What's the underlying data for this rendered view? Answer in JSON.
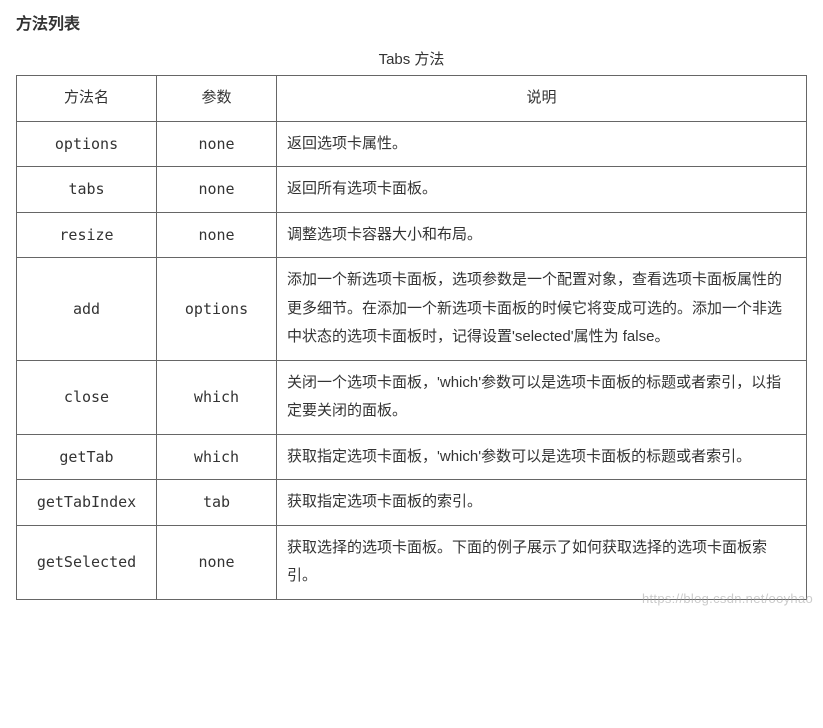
{
  "section_title": "方法列表",
  "table_caption": "Tabs 方法",
  "headers": {
    "method": "方法名",
    "param": "参数",
    "desc": "说明"
  },
  "rows": [
    {
      "method": "options",
      "param": "none",
      "desc": "返回选项卡属性。"
    },
    {
      "method": "tabs",
      "param": "none",
      "desc": "返回所有选项卡面板。"
    },
    {
      "method": "resize",
      "param": "none",
      "desc": "调整选项卡容器大小和布局。"
    },
    {
      "method": "add",
      "param": "options",
      "desc": "添加一个新选项卡面板，选项参数是一个配置对象，查看选项卡面板属性的更多细节。在添加一个新选项卡面板的时候它将变成可选的。添加一个非选中状态的选项卡面板时，记得设置'selected'属性为 false。"
    },
    {
      "method": "close",
      "param": "which",
      "desc": "关闭一个选项卡面板，'which'参数可以是选项卡面板的标题或者索引，以指定要关闭的面板。"
    },
    {
      "method": "getTab",
      "param": "which",
      "desc": "获取指定选项卡面板，'which'参数可以是选项卡面板的标题或者索引。"
    },
    {
      "method": "getTabIndex",
      "param": "tab",
      "desc": "获取指定选项卡面板的索引。"
    },
    {
      "method": "getSelected",
      "param": "none",
      "desc": "获取选择的选项卡面板。下面的例子展示了如何获取选择的选项卡面板索引。"
    }
  ],
  "watermark": "https://blog.csdn.net/ooyhao"
}
